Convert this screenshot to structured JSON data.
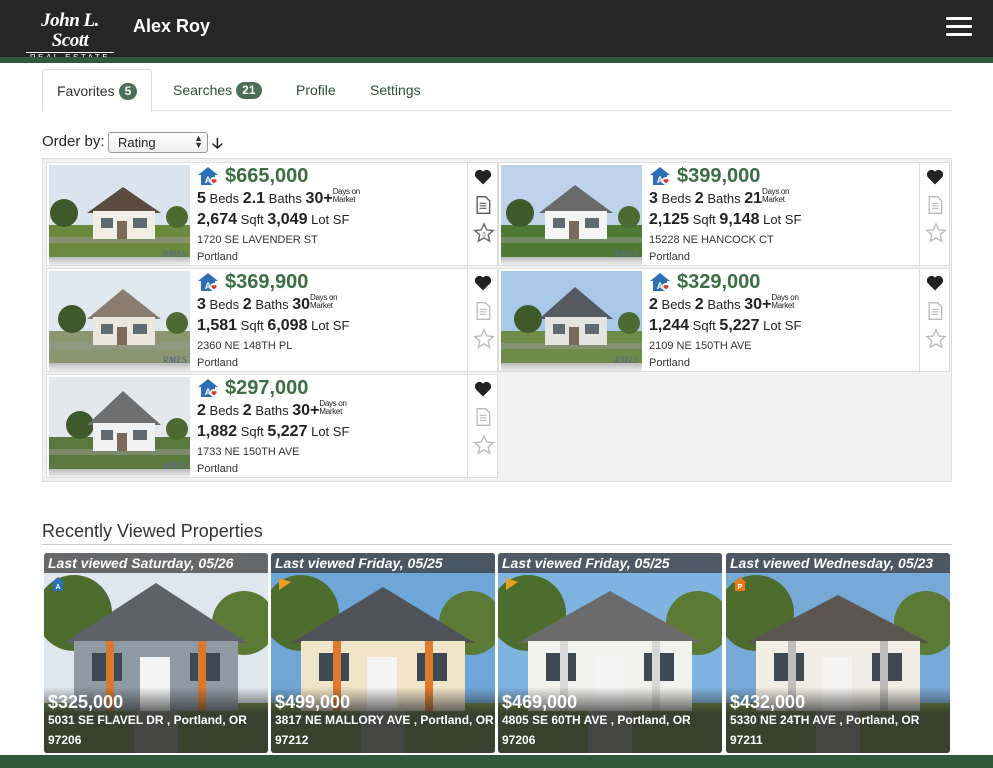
{
  "header": {
    "logo_line1": "John L. Scott",
    "logo_line2": "REAL ESTATE",
    "user_name": "Alex Roy"
  },
  "tabs": [
    {
      "label": "Favorites",
      "count": "5",
      "active": true
    },
    {
      "label": "Searches",
      "count": "21",
      "active": false
    },
    {
      "label": "Profile",
      "count": "",
      "active": false
    },
    {
      "label": "Settings",
      "count": "",
      "active": false
    }
  ],
  "order": {
    "label": "Order by:",
    "selected": "Rating",
    "direction_icon": "arrow-down-icon"
  },
  "favorites": [
    {
      "price": "$665,000",
      "beds": "5",
      "baths": "2.1",
      "days": "30+",
      "sqft": "2,674",
      "lot": "3,049",
      "address": "1720 SE LAVENDER ST",
      "city": "Portland",
      "watermark": "RMLS",
      "rated": true
    },
    {
      "price": "$399,000",
      "beds": "3",
      "baths": "2",
      "days": "21",
      "sqft": "2,125",
      "lot": "9,148",
      "address": "15228 NE HANCOCK CT",
      "city": "Portland",
      "watermark": "RMLS",
      "rated": false
    },
    {
      "price": "$369,900",
      "beds": "3",
      "baths": "2",
      "days": "30",
      "sqft": "1,581",
      "lot": "6,098",
      "address": "2360 NE 148TH PL",
      "city": "Portland",
      "watermark": "RMLS",
      "rated": false
    },
    {
      "price": "$329,000",
      "beds": "2",
      "baths": "2",
      "days": "30+",
      "sqft": "1,244",
      "lot": "5,227",
      "address": "2109 NE 150TH AVE",
      "city": "Portland",
      "watermark": "RMLS",
      "rated": false
    },
    {
      "price": "$297,000",
      "beds": "2",
      "baths": "2",
      "days": "30+",
      "sqft": "1,882",
      "lot": "5,227",
      "address": "1733 NE 150TH AVE",
      "city": "Portland",
      "watermark": "RMLS",
      "rated": false
    }
  ],
  "labels": {
    "beds": "Beds",
    "baths": "Baths",
    "days_line1": "Days on",
    "days_line2": "Market",
    "sqft": "Sqft",
    "lot": "Lot SF"
  },
  "recent": {
    "title": "Recently Viewed Properties",
    "items": [
      {
        "viewed": "Last viewed Saturday, 05/26",
        "price": "$325,000",
        "address": "5031 SE FLAVEL DR , Portland, OR 97206",
        "icon": "house-blue-icon"
      },
      {
        "viewed": "Last viewed Friday, 05/25",
        "price": "$499,000",
        "address": "3817 NE MALLORY AVE , Portland, OR 97212",
        "icon": "flag-orange-icon"
      },
      {
        "viewed": "Last viewed Friday, 05/25",
        "price": "$469,000",
        "address": "4805 SE 60TH AVE , Portland, OR 97206",
        "icon": "flag-orange-icon"
      },
      {
        "viewed": "Last viewed Wednesday, 05/23",
        "price": "$432,000",
        "address": "5330 NE 24TH AVE , Portland, OR 97211",
        "icon": "house-orange-icon"
      }
    ]
  },
  "colors": {
    "brand_green": "#2f5a3a",
    "price_green": "#3c6e45",
    "header_bg": "#262626"
  }
}
